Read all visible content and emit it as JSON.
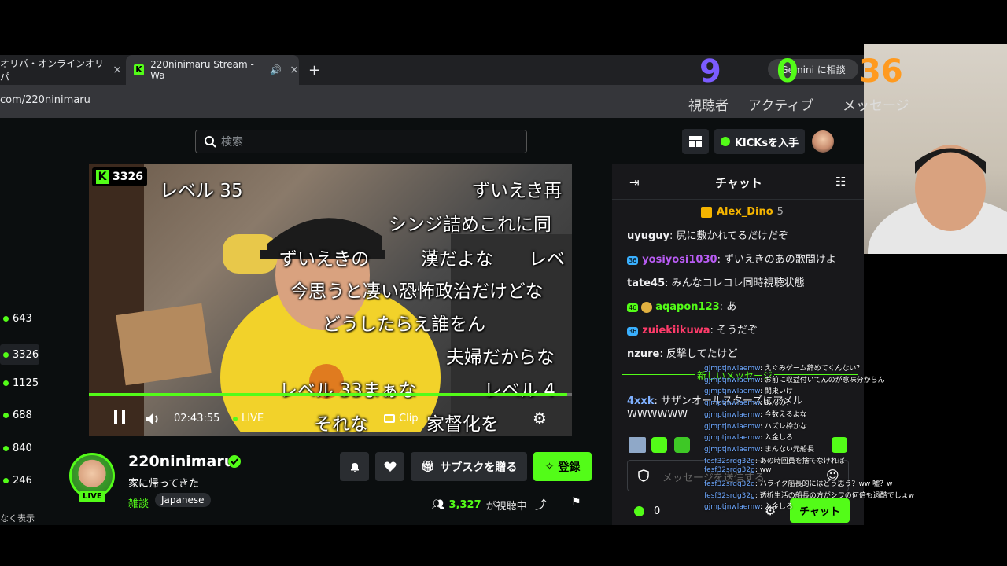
{
  "browser": {
    "tabs": [
      {
        "title": "オリパ・オンラインオリパ",
        "close": "×"
      },
      {
        "title": "220ninimaru Stream - Wa",
        "close": "×",
        "active": true
      }
    ],
    "new_tab": "+",
    "url": "com/220ninimaru",
    "gemini_label": "Gemini に相談"
  },
  "overlay_stats": {
    "viewers_value": "9",
    "viewers_label": "視聴者",
    "active_value": "0",
    "active_label": "アクティブ",
    "messages_value": "36",
    "messages_label": "メッセージ",
    "viewers_color": "#7b5cff",
    "active_color": "#53fc18",
    "messages_color": "#ff9a1f"
  },
  "site": {
    "search_placeholder": "検索",
    "get_kicks": "KICKsを入手",
    "brand_color": "#53fc18"
  },
  "sidebar": {
    "counts": [
      "643",
      "3326",
      "1125",
      "688",
      "840",
      "246"
    ],
    "show_less": "なく表示"
  },
  "player": {
    "viewer_badge": "3326",
    "time": "02:43:55",
    "live": "LIVE",
    "clip": "Clip",
    "progress": 0.99,
    "danmaku": [
      "レベル 35",
      "ずいえき再",
      "シンジ詰めこれに同",
      "ずいえきの",
      "漢だよな",
      "レベ",
      "今思うと凄い恐怖政治だけどな",
      "どうしたらえ誰をん",
      "夫婦だからな",
      "レベル 33まぁな",
      "レベル 4",
      "それな",
      "家督化を"
    ]
  },
  "stream": {
    "channel": "220ninimaru",
    "title": "家に帰ってきた",
    "category": "雑談",
    "tag": "Japanese",
    "live_badge": "LIVE",
    "gift_sub": "サブスクを贈る",
    "follow": "登録",
    "viewers": "3,327",
    "viewers_suffix": "が視聴中"
  },
  "chat": {
    "header": "チャット",
    "pinned_user": "Alex_Dino",
    "pinned_count": "5",
    "messages": [
      {
        "user": "uyuguy",
        "text": "尻に敷かれてるだけだぞ",
        "color": "#efeff1",
        "badge": ""
      },
      {
        "user": "yosiyosi1030",
        "text": "ずいえきのあの歌間けよ",
        "color": "#b95cf4",
        "badge": "36"
      },
      {
        "user": "tate45",
        "text": "みんなコレコレ同時視聴状態",
        "color": "#efeff1",
        "badge": ""
      },
      {
        "user": "aqapon123",
        "text": "あ",
        "color": "#53fc18",
        "badge": "46"
      },
      {
        "user": "zuiekiikuwa",
        "text": "そうだぞ",
        "color": "#ff3b6a",
        "badge": "36"
      },
      {
        "user": "nzure",
        "text": "反撃してたけど",
        "color": "#efeff1",
        "badge": ""
      }
    ],
    "new_messages": "新しいメッセージ",
    "msg7_user": "4xxk",
    "msg7_text": "サザンオールスターズにアメル",
    "msg7_text2": "WWWWWW",
    "input_placeholder": "メッセージを送信する",
    "kicks_count": "0",
    "send": "チャット"
  },
  "overlay_comments": [
    {
      "user": "gjmptjnwlaemw",
      "text": "えぐみゲーム辞めてくんない？"
    },
    {
      "user": "gjmptjnwlaemw",
      "text": "お前に収益付いてんのが意味分からん"
    },
    {
      "user": "gjmptjnwlaemw",
      "text": "間東いけ"
    },
    {
      "user": "gjmptjnwlaemw",
      "text": "あんの？"
    },
    {
      "user": "gjmptjnwlaemw",
      "text": "今数えるよな"
    },
    {
      "user": "gjmptjnwlaemw",
      "text": "ハズレ枠かな"
    },
    {
      "user": "gjmptjnwlaemw",
      "text": "入金しろ"
    },
    {
      "user": "gjmptjnwlaemw",
      "text": "まんない元船長"
    },
    {
      "user": "fesf32srdg32g",
      "text": "あの時回員を捨てなければ"
    },
    {
      "user": "fesf32srdg32g",
      "text": "ww"
    },
    {
      "user": "fesf32srdg32g",
      "text": "ハライク船長的にはどう思う？ww 嘘？w"
    },
    {
      "user": "fesf32srdg32g",
      "text": "透析生活の船長の方がシワの何倍も過酷でしょw"
    },
    {
      "user": "gjmptjnwlaemw",
      "text": "入金しろ"
    }
  ]
}
